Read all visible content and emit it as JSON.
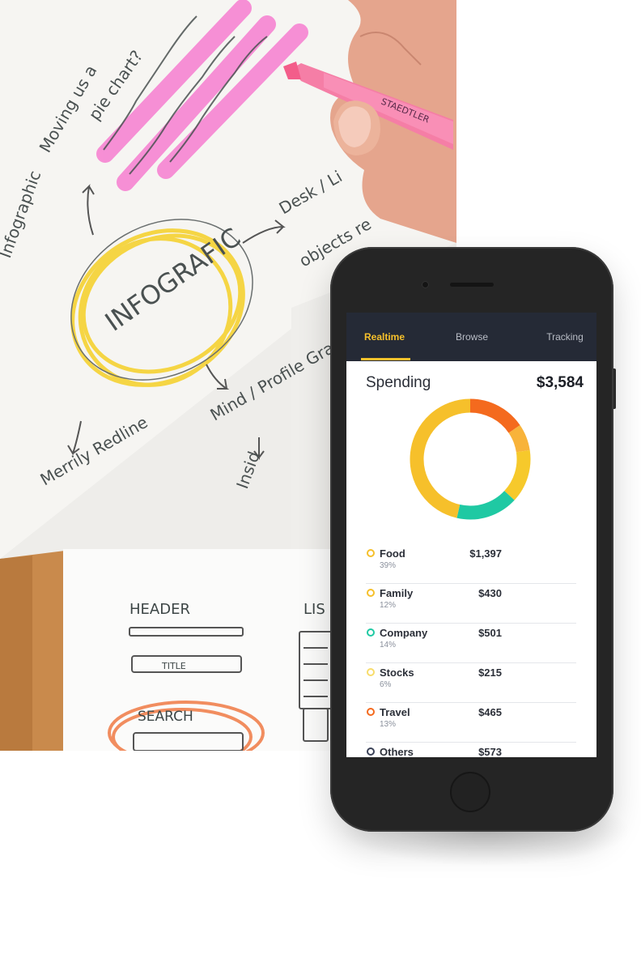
{
  "tabs": [
    {
      "label": "Realtime",
      "active": true
    },
    {
      "label": "Browse",
      "active": false
    },
    {
      "label": "Tracking",
      "active": false
    }
  ],
  "spending": {
    "title": "Spending",
    "total": "$3,584"
  },
  "categories": [
    {
      "name": "Food",
      "amount": "$1,397",
      "percent": "39%",
      "color": "#f6c02b"
    },
    {
      "name": "Family",
      "amount": "$430",
      "percent": "12%",
      "color": "#f6c02b"
    },
    {
      "name": "Company",
      "amount": "$501",
      "percent": "14%",
      "color": "#1fc9a3"
    },
    {
      "name": "Stocks",
      "amount": "$215",
      "percent": "6%",
      "color": "#f8dc6b"
    },
    {
      "name": "Travel",
      "amount": "$465",
      "percent": "13%",
      "color": "#f46a1e"
    },
    {
      "name": "Others",
      "amount": "$573",
      "percent": "",
      "color": "#3b4258"
    }
  ],
  "chart_data": {
    "type": "pie",
    "categories": [
      "Travel",
      "Stocks",
      "Family",
      "Company",
      "Food"
    ],
    "values": [
      13,
      6,
      12,
      14,
      39
    ],
    "colors": [
      "#f46a1e",
      "#f8b33a",
      "#f6c92b",
      "#1fc9a3",
      "#f6c02b"
    ]
  },
  "photo": {
    "handwriting": [
      "INFOGRAFIC",
      "HEADER",
      "TITLE",
      "SEARCH",
      "Desk / Li",
      "Mind / Profile Graphic",
      "Infographic",
      "pie chart?",
      "objects re"
    ]
  },
  "colors": {
    "accent": "#f6c02b",
    "navbar": "#252a36",
    "phone_body": "#252525"
  }
}
